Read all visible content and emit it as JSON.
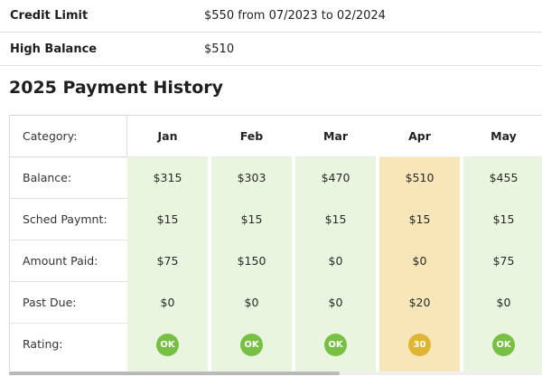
{
  "summary": {
    "credit_limit_label": "Credit Limit",
    "credit_limit_value": "$550 from 07/2023 to 02/2024",
    "high_balance_label": "High Balance",
    "high_balance_value": "$510"
  },
  "section_title": "2025 Payment History",
  "table": {
    "category_header": "Category:",
    "row_labels": [
      "Balance:",
      "Sched Paymnt:",
      "Amount Paid:",
      "Past Due:",
      "Rating:"
    ],
    "months": [
      {
        "name": "Jan",
        "balance": "$315",
        "sched": "$15",
        "paid": "$75",
        "past_due": "$0",
        "rating": "OK",
        "status": "ok"
      },
      {
        "name": "Feb",
        "balance": "$303",
        "sched": "$15",
        "paid": "$150",
        "past_due": "$0",
        "rating": "OK",
        "status": "ok"
      },
      {
        "name": "Mar",
        "balance": "$470",
        "sched": "$15",
        "paid": "$0",
        "past_due": "$0",
        "rating": "OK",
        "status": "ok"
      },
      {
        "name": "Apr",
        "balance": "$510",
        "sched": "$15",
        "paid": "$0",
        "past_due": "$20",
        "rating": "30",
        "status": "late"
      },
      {
        "name": "May",
        "balance": "$455",
        "sched": "$15",
        "paid": "$75",
        "past_due": "$0",
        "rating": "OK",
        "status": "ok"
      }
    ]
  },
  "colors": {
    "ok_column": "#e9f5df",
    "late_column": "#f7e7b8",
    "ok_badge": "#77c043",
    "late_badge": "#e1b534"
  },
  "scroll": {
    "horizontal_position": 0.0
  }
}
